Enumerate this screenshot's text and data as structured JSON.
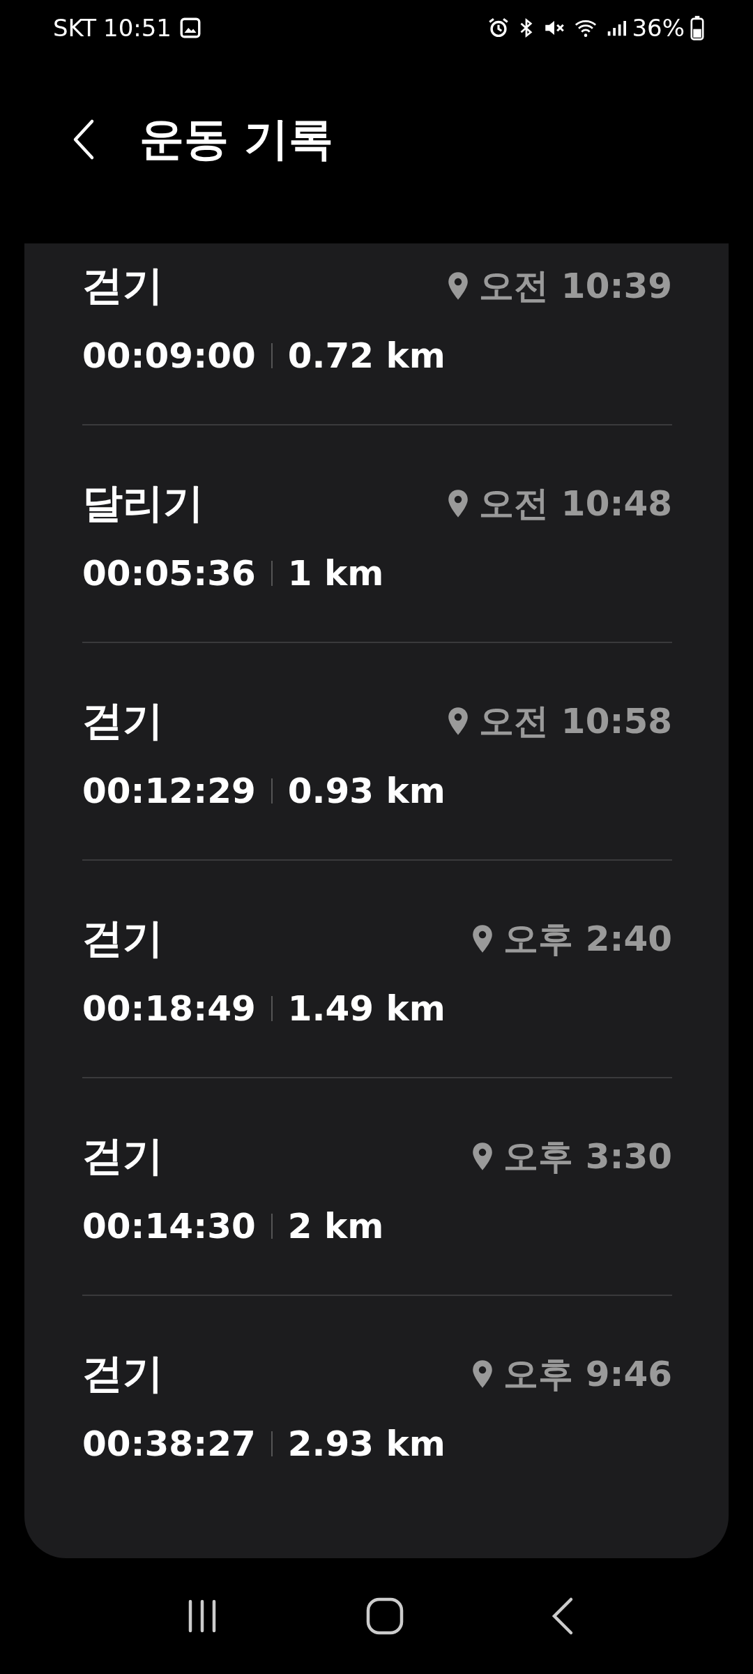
{
  "status_bar": {
    "carrier": "SKT",
    "time": "10:51",
    "battery": "36%"
  },
  "header": {
    "title": "운동 기록"
  },
  "records": [
    {
      "activity": "걷기",
      "time": "오전 10:39",
      "duration": "00:09:00",
      "distance": "0.72 km"
    },
    {
      "activity": "달리기",
      "time": "오전 10:48",
      "duration": "00:05:36",
      "distance": "1 km"
    },
    {
      "activity": "걷기",
      "time": "오전 10:58",
      "duration": "00:12:29",
      "distance": "0.93 km"
    },
    {
      "activity": "걷기",
      "time": "오후 2:40",
      "duration": "00:18:49",
      "distance": "1.49 km"
    },
    {
      "activity": "걷기",
      "time": "오후 3:30",
      "duration": "00:14:30",
      "distance": "2 km"
    },
    {
      "activity": "걷기",
      "time": "오후 9:46",
      "duration": "00:38:27",
      "distance": "2.93 km"
    }
  ]
}
